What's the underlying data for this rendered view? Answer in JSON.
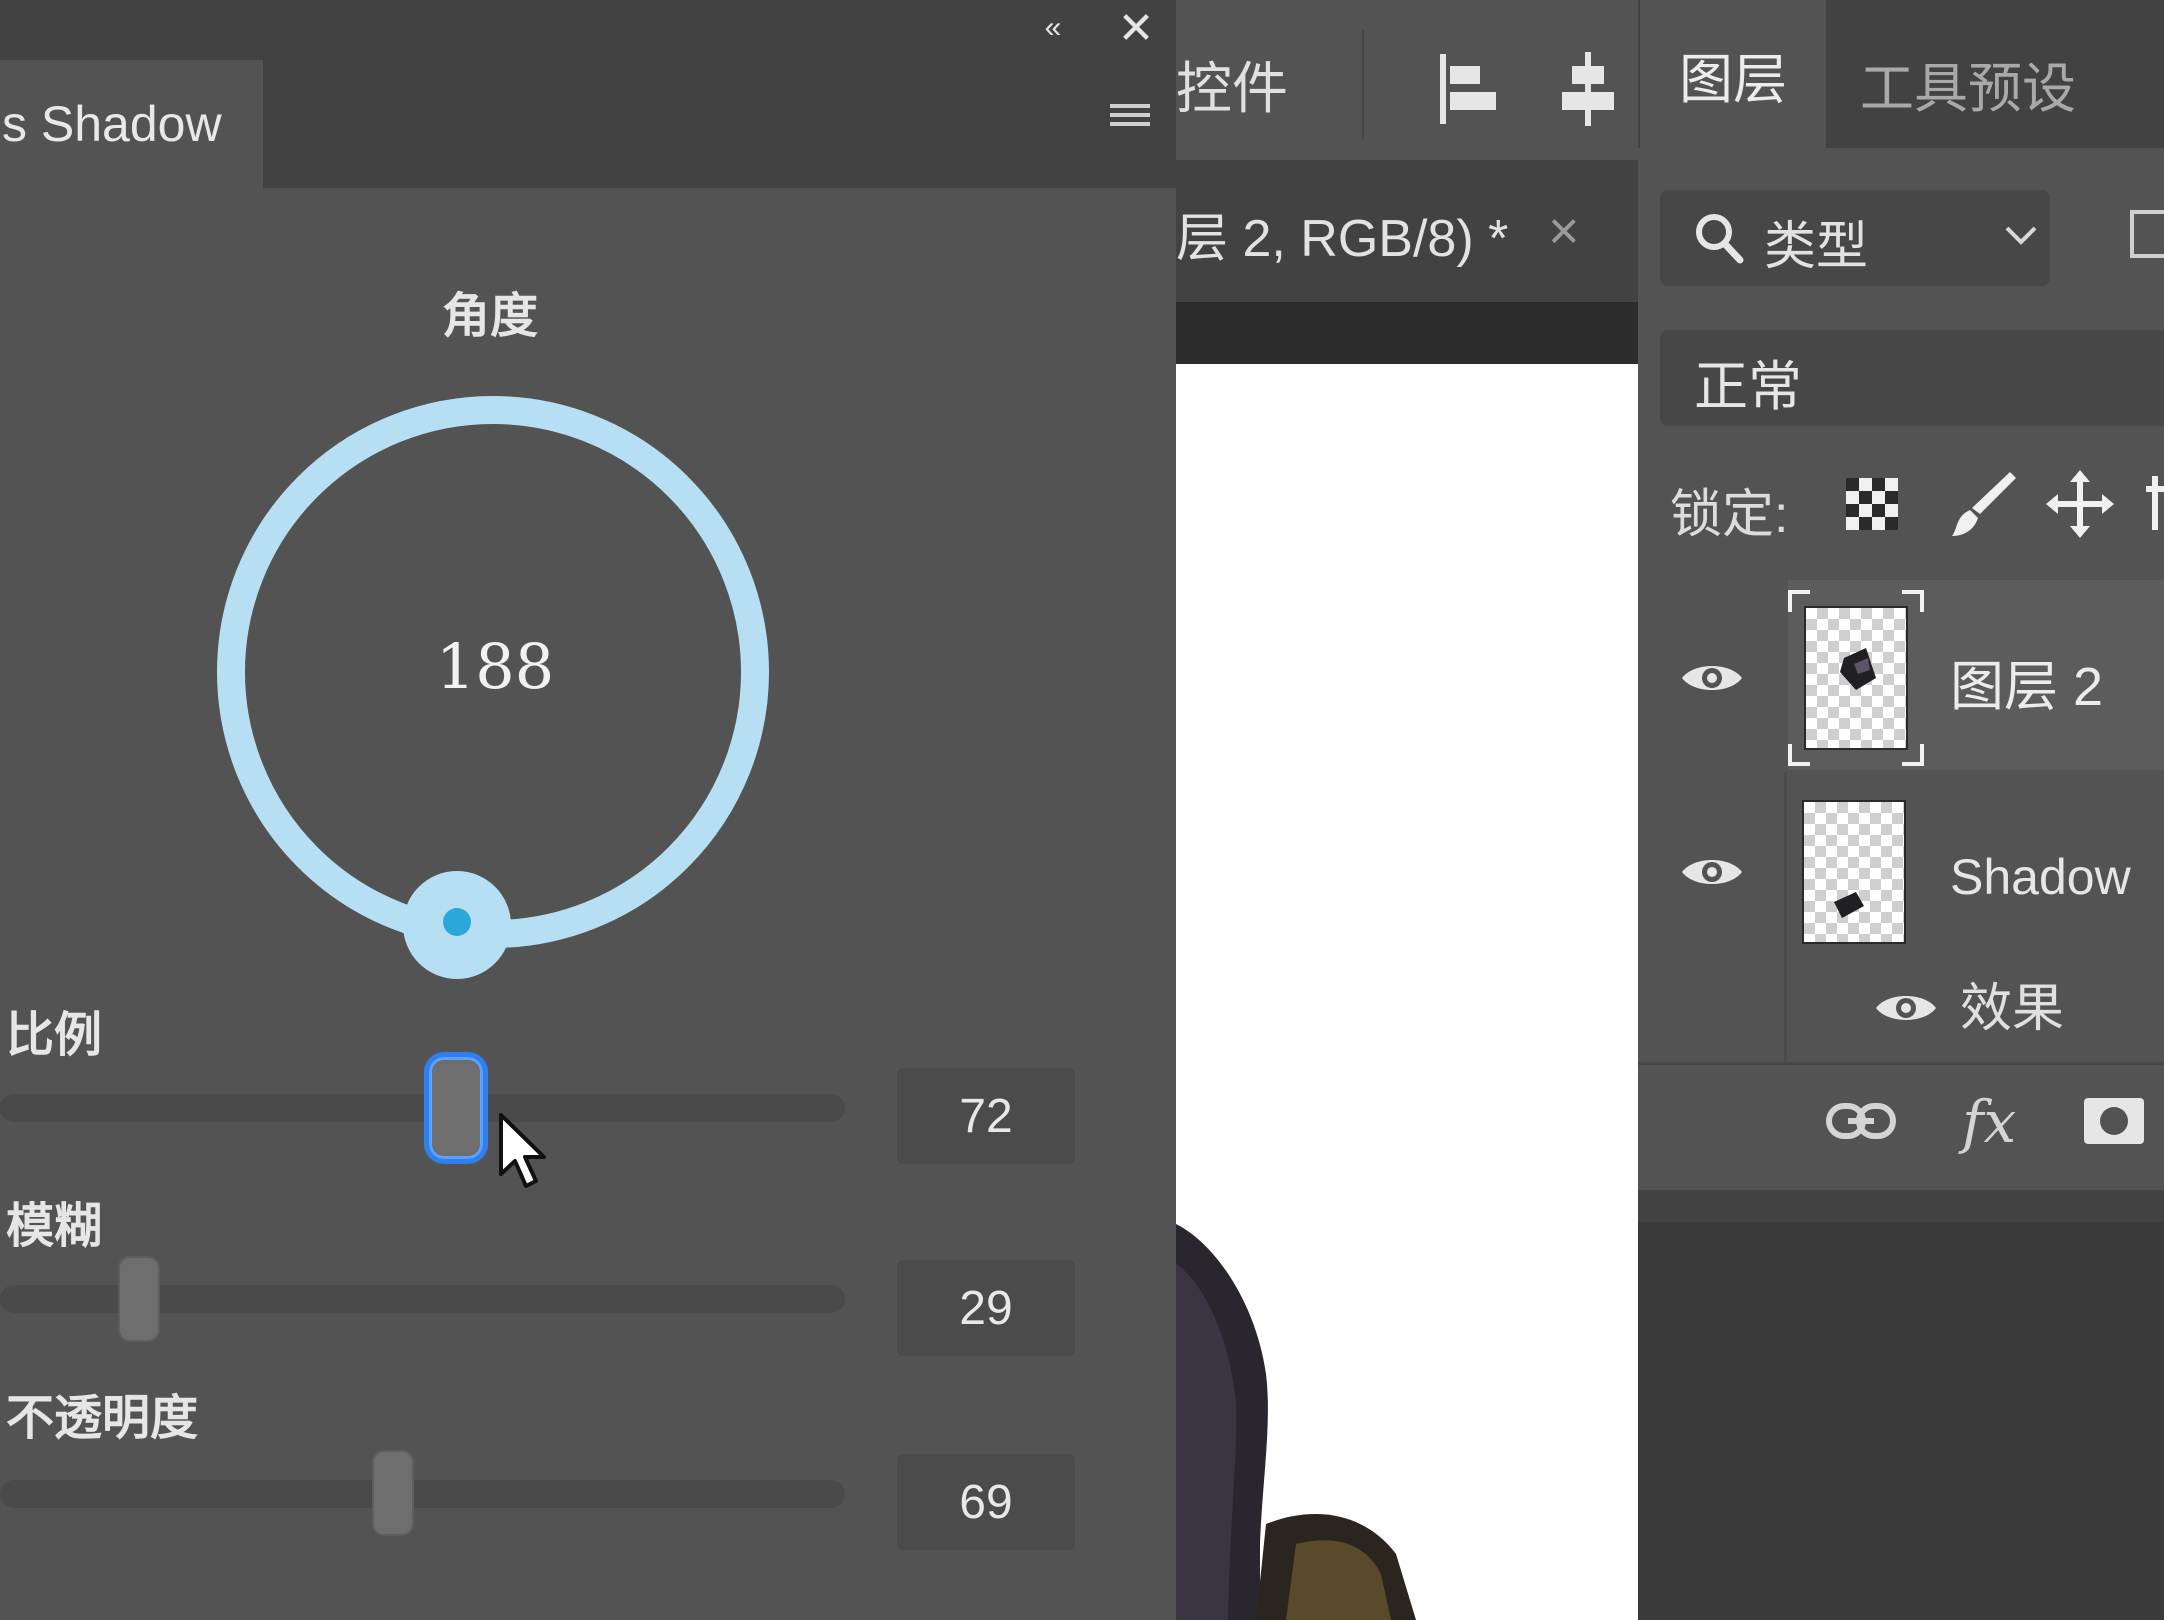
{
  "plugin": {
    "tab_title": "s Shadow",
    "collapse_glyph": "«",
    "close_glyph": "✕",
    "angle": {
      "label": "角度",
      "value": "188"
    },
    "sliders": [
      {
        "label": "比例",
        "value": "72",
        "fraction": 0.54,
        "active": true
      },
      {
        "label": "模糊",
        "value": "29",
        "fraction": 0.165
      },
      {
        "label": "不透明度",
        "value": "69",
        "fraction": 0.465
      }
    ]
  },
  "options_bar": {
    "label": "控件"
  },
  "document": {
    "tab_title": "层 2, RGB/8) *",
    "close_glyph": "×"
  },
  "layers_panel": {
    "tabs": {
      "layers": "图层",
      "tool_presets": "工具预设"
    },
    "filter": {
      "label": "类型"
    },
    "blend_mode": "正常",
    "lock_label": "锁定:",
    "layers": [
      {
        "name": "图层 2",
        "selected": true
      },
      {
        "name": "Shadow",
        "effects_label": "效果"
      }
    ],
    "footer": {
      "fx_label": "fx"
    }
  },
  "colors": {
    "panel_bg": "#535353",
    "dial_ring": "#b6dff3",
    "dial_dot": "#2aa8d8",
    "slider_active_border": "#2f7ff0"
  }
}
